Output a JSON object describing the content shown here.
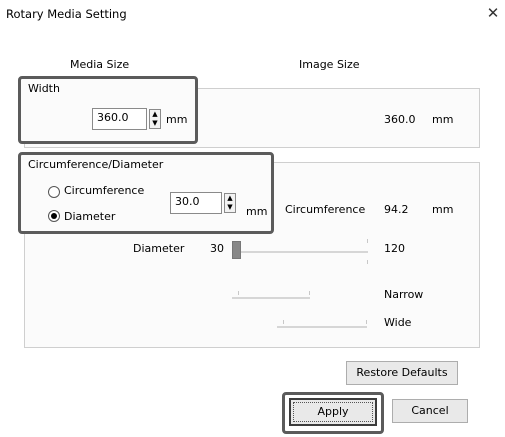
{
  "window": {
    "title": "Rotary Media Setting"
  },
  "headers": {
    "media_size": "Media Size",
    "image_size": "Image Size"
  },
  "width_group": {
    "label": "Width",
    "value": "360.0",
    "unit": "mm",
    "image_value": "360.0",
    "image_unit": "mm"
  },
  "circ_group": {
    "label": "Circumference/Diameter",
    "circumference_option": "Circumference",
    "diameter_option": "Diameter",
    "selected": "Diameter",
    "value": "30.0",
    "unit": "mm",
    "image_label": "Circumference",
    "image_value": "94.2",
    "image_unit": "mm"
  },
  "slider": {
    "label": "Diameter",
    "min": "30",
    "max": "120",
    "value": 30
  },
  "spacing": {
    "narrow": "Narrow",
    "wide": "Wide"
  },
  "buttons": {
    "restore": "Restore Defaults",
    "apply": "Apply",
    "cancel": "Cancel"
  }
}
